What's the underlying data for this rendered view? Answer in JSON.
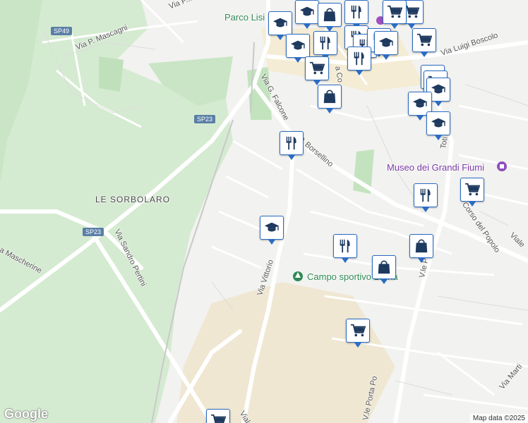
{
  "map": {
    "area_labels": [
      {
        "id": "le-sorbolaro",
        "text": "LE SORBOLARO"
      }
    ],
    "street_labels": [
      {
        "id": "via-p-mascagni",
        "text": "Via P. Mascagni"
      },
      {
        "id": "via-p-top",
        "text": "Via P..."
      },
      {
        "id": "via-luigi-boscolo",
        "text": "Via Luigi Boscolo"
      },
      {
        "id": "via-falcone",
        "text": "Via G. Falcone"
      },
      {
        "id": "via-borsellino",
        "text": "P. Borsellino"
      },
      {
        "id": "via-vittorio",
        "text": "Via Vittorio"
      },
      {
        "id": "via-sandro-pertini",
        "text": "Via Sandro Pertini"
      },
      {
        "id": "via-mascherine",
        "text": "a Mascherine"
      },
      {
        "id": "corso-del-popolo",
        "text": "Corso del Popolo"
      },
      {
        "id": "vle-porta-po",
        "text": "V.le Porta Po"
      },
      {
        "id": "vle-porta-po-2",
        "text": "V.le Porta Po"
      },
      {
        "id": "via-toti",
        "text": "Toti"
      },
      {
        "id": "viale-right",
        "text": "Viale"
      },
      {
        "id": "via-marti",
        "text": "Via Marti"
      },
      {
        "id": "viale-bottom",
        "text": "Viale"
      },
      {
        "id": "via-co",
        "text": "a Co"
      }
    ],
    "road_shields": [
      {
        "id": "sp49",
        "text": "SP49"
      },
      {
        "id": "sp23-a",
        "text": "SP23"
      },
      {
        "id": "sp23-b",
        "text": "SP23"
      }
    ],
    "poi_labels": [
      {
        "id": "parco-lisi",
        "text": "Parco Lisi"
      },
      {
        "id": "museo",
        "text": "Museo dei Grandi Fiumi"
      },
      {
        "id": "campo-sportivo",
        "text": "Campo sportivo Lisina"
      }
    ],
    "markers": [
      {
        "icon": "school-icon"
      },
      {
        "icon": "school-icon"
      },
      {
        "icon": "shopping-bag-icon"
      },
      {
        "icon": "restaurant-icon"
      },
      {
        "icon": "cart-icon"
      },
      {
        "icon": "cart-icon"
      },
      {
        "icon": "restaurant-icon"
      },
      {
        "icon": "restaurant-icon"
      },
      {
        "icon": "school-icon"
      },
      {
        "icon": "restaurant-icon"
      },
      {
        "icon": "restaurant-icon"
      },
      {
        "icon": "cart-icon"
      },
      {
        "icon": "school-icon"
      },
      {
        "icon": "cart-icon"
      },
      {
        "icon": "restaurant-icon"
      },
      {
        "icon": "cart-icon"
      },
      {
        "icon": "shopping-bag-icon"
      },
      {
        "icon": "cart-icon"
      },
      {
        "icon": "school-icon"
      },
      {
        "icon": "school-icon"
      },
      {
        "icon": "school-icon"
      },
      {
        "icon": "restaurant-icon"
      },
      {
        "icon": "restaurant-icon"
      },
      {
        "icon": "cart-icon"
      },
      {
        "icon": "school-icon"
      },
      {
        "icon": "restaurant-icon"
      },
      {
        "icon": "shopping-bag-icon"
      },
      {
        "icon": "shopping-bag-icon"
      },
      {
        "icon": "cart-icon"
      },
      {
        "icon": "cart-icon"
      }
    ],
    "branding": {
      "logo": "Google",
      "attribution": "Map data ©2025"
    },
    "colors": {
      "marker_border": "#2b6cc4",
      "marker_icon": "#1f3a5f",
      "park": "#c8e6c4",
      "green_area": "#d6ecd2",
      "road": "#ffffff",
      "urban_tan": "#efe6d0"
    }
  }
}
